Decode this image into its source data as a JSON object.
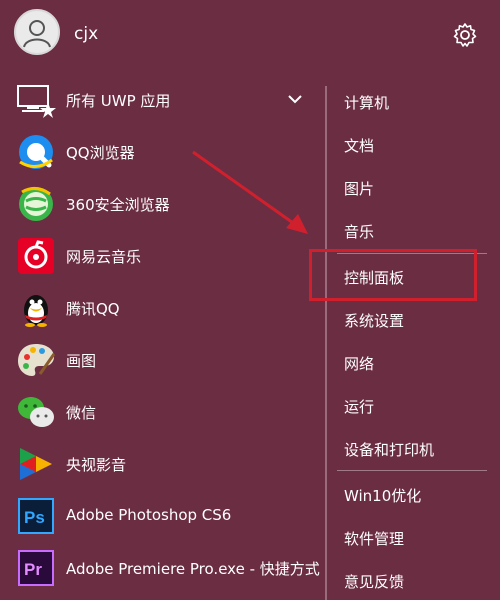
{
  "user": {
    "name": "cjx"
  },
  "icons": {
    "avatar": "user-avatar-icon",
    "settings": "gear-icon",
    "expand": "chevron-down-icon"
  },
  "apps": [
    {
      "label": "所有 UWP 应用",
      "icon": "uwp-apps-icon",
      "expandable": true
    },
    {
      "label": "QQ浏览器",
      "icon": "qq-browser-icon"
    },
    {
      "label": "360安全浏览器",
      "icon": "360-browser-icon"
    },
    {
      "label": "网易云音乐",
      "icon": "netease-music-icon"
    },
    {
      "label": "腾讯QQ",
      "icon": "qq-penguin-icon"
    },
    {
      "label": "画图",
      "icon": "paint-icon"
    },
    {
      "label": "微信",
      "icon": "wechat-icon"
    },
    {
      "label": "央视影音",
      "icon": "cctv-video-icon"
    },
    {
      "label": "Adobe Photoshop CS6",
      "icon": "photoshop-icon"
    },
    {
      "label": "Adobe Premiere Pro.exe - 快捷方式",
      "icon": "premiere-icon"
    }
  ],
  "places": [
    {
      "label": "计算机"
    },
    {
      "label": "文档"
    },
    {
      "label": "图片"
    },
    {
      "label": "音乐"
    },
    {
      "label": "控制面板",
      "highlighted": true
    },
    {
      "label": "系统设置"
    },
    {
      "label": "网络"
    },
    {
      "label": "运行"
    },
    {
      "label": "设备和打印机"
    },
    {
      "label": "Win10优化"
    },
    {
      "label": "软件管理"
    },
    {
      "label": "意见反馈"
    }
  ],
  "colors": {
    "background": "#6b2d42",
    "highlight": "#d0202e",
    "text": "#ffffff"
  }
}
